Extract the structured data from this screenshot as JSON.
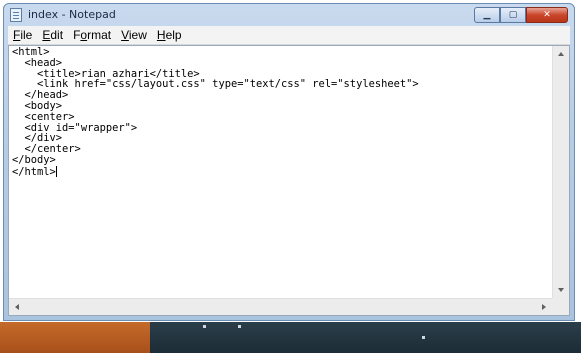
{
  "window": {
    "title": "index - Notepad",
    "controls": {
      "minimize": "▁",
      "maximize": "▢",
      "close": "✕"
    }
  },
  "menu": [
    {
      "underline": "F",
      "rest": "ile"
    },
    {
      "underline": "E",
      "rest": "dit"
    },
    {
      "underline": "F",
      "rest": "ormat",
      "order": "Format"
    },
    {
      "underline": "V",
      "rest": "iew"
    },
    {
      "underline": "H",
      "rest": "elp"
    }
  ],
  "editor": {
    "content": "<html>\n  <head>\n    <title>rian azhari</title>\n    <link href=\"css/layout.css\" type=\"text/css\" rel=\"stylesheet\">\n  </head>\n  <body>\n  <center>\n  <div id=\"wrapper\">\n  </div>\n  </center>\n</body>\n</html>"
  },
  "colors": {
    "title_bar": "#b7cde6",
    "close_button": "#c9462b",
    "taskbar": "#1d2c36",
    "taskbar_accent": "#c46a2a"
  }
}
